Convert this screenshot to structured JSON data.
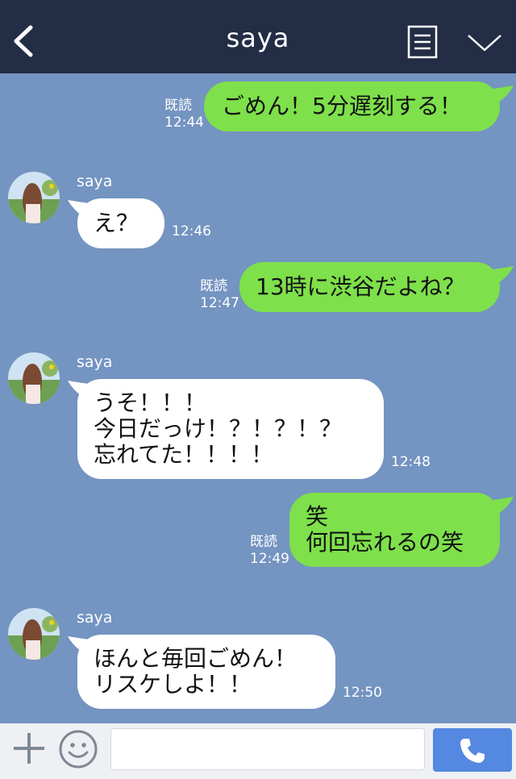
{
  "header": {
    "title": "saya",
    "icons": [
      "back-icon",
      "notes-icon",
      "chevron-down-icon"
    ]
  },
  "messages": [
    {
      "dir": "out",
      "text": "ごめん！5分遅刻する！",
      "read": "既読",
      "time": "12:44"
    },
    {
      "dir": "in",
      "sender": "saya",
      "text": "え？",
      "time": "12:46"
    },
    {
      "dir": "out",
      "text": "13時に渋谷だよね？",
      "read": "既読",
      "time": "12:47"
    },
    {
      "dir": "in",
      "sender": "saya",
      "text": "うそ！！！\n今日だっけ！？！？！？\n忘れてた！！！！",
      "time": "12:48"
    },
    {
      "dir": "out",
      "text": "笑\n何回忘れるの笑",
      "read": "既読",
      "time": "12:49"
    },
    {
      "dir": "in",
      "sender": "saya",
      "text": "ほんと毎回ごめん！\nリスケしよ！！",
      "time": "12:50"
    }
  ],
  "footer": {
    "input_value": "",
    "icons": [
      "plus-icon",
      "emoji-icon",
      "phone-icon"
    ]
  },
  "colors": {
    "background": "#7494c1",
    "header": "#232d45",
    "outgoing_bubble": "#7ee04b",
    "incoming_bubble": "#ffffff",
    "call_button": "#5588e0"
  }
}
